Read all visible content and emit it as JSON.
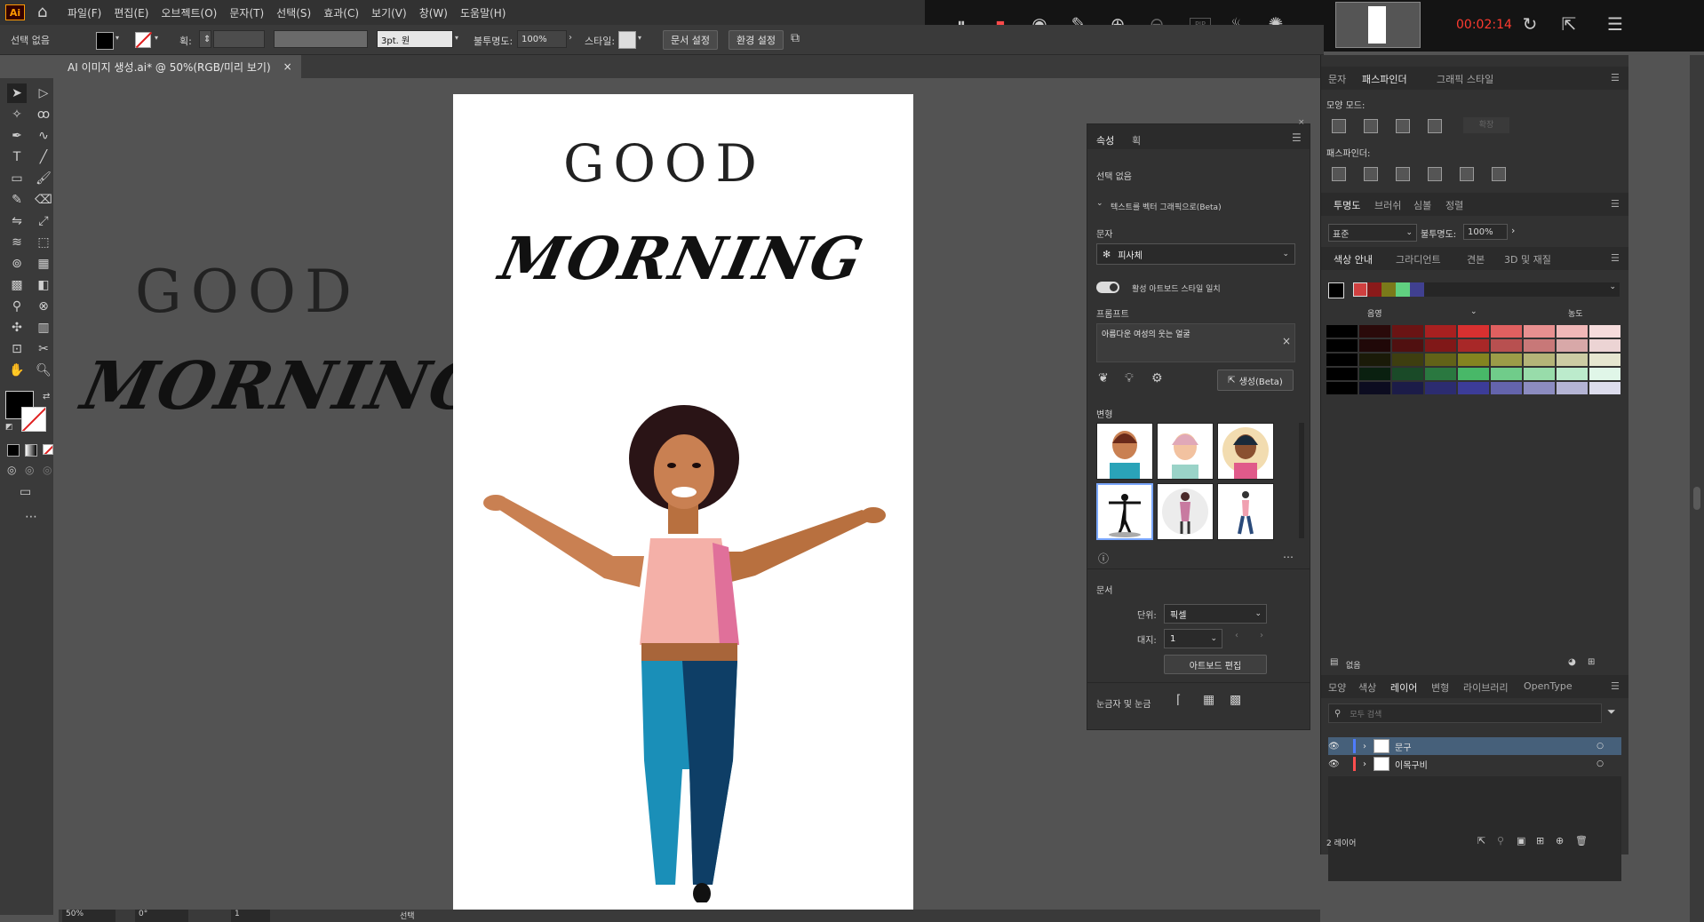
{
  "menubar": {
    "logo": "Ai",
    "items": [
      "파일(F)",
      "편집(E)",
      "오브젝트(O)",
      "문자(T)",
      "선택(S)",
      "효과(C)",
      "보기(V)",
      "창(W)",
      "도움말(H)"
    ]
  },
  "recorder": {
    "time": "00:02:14",
    "zoom_label": "x1",
    "pip_label": "PIP"
  },
  "control_bar": {
    "selection": "선택 없음",
    "stroke_label": "획:",
    "brush_value": "3pt. 원",
    "opacity_label": "불투명도:",
    "opacity_value": "100%",
    "style_label": "스타일:",
    "doc_setup_button": "문서 설정",
    "prefs_button": "환경 설정"
  },
  "document_tab": {
    "title": "AI 이미지 생성.ai* @ 50%(RGB/미리 보기)",
    "close": "×"
  },
  "canvas": {
    "left_good": "GOOD",
    "left_morning": "MORNING",
    "art_good": "GOOD",
    "art_morning": "MORNING"
  },
  "properties_panel": {
    "tabs": [
      "속성",
      "획"
    ],
    "no_selection": "선택 없음",
    "vectorize_header": "텍스트를 벡터 그래픽으로(Beta)",
    "type_label": "문자",
    "type_value": "피사체",
    "toggle_label": "활성 아트보드 스타일 일치",
    "prompt_label": "프롬프트",
    "prompt_text": "아름다운 여성의 웃는 얼굴",
    "generate_button": "생성(Beta)",
    "variants_label": "변형",
    "document_label": "문서",
    "unit_label": "단위:",
    "unit_value": "픽셀",
    "artboard_label": "대지:",
    "artboard_value": "1",
    "edit_artboard_button": "아트보드 편집",
    "rulers_label": "눈금자 및 눈금"
  },
  "dock": {
    "top_tabs": [
      "문자",
      "패스파인더",
      "그래픽 스타일"
    ],
    "shape_mode_label": "모양 모드:",
    "expand_button": "확장",
    "pathfinder_label": "패스파인더:",
    "transparency_tabs": [
      "투명도",
      "브러쉬",
      "심볼",
      "정렬"
    ],
    "blend_mode": "표준",
    "opacity_label": "불투명도:",
    "opacity_value": "100%",
    "color_tabs": [
      "색상 안내",
      "그라디언트",
      "견본",
      "3D 및 재질"
    ],
    "shade_label": "음영",
    "vivid_label": "농도",
    "guide_footer": "없음",
    "layer_tabs": [
      "모양",
      "색상",
      "레이어",
      "변형",
      "라이브러리",
      "OpenType"
    ],
    "search_placeholder": "모두 검색",
    "layers": [
      {
        "name": "문구",
        "color": "#4f7cff"
      },
      {
        "name": "이목구비",
        "color": "#ff4f4f"
      }
    ],
    "layer_count": "2 레이어"
  },
  "status_bar": {
    "zoom": "50%",
    "rotation": "0°",
    "artboard": "1",
    "tool": "선택"
  },
  "colors": {
    "accent_red": "#ff3b30",
    "panel_bg": "#323232",
    "ui_bg": "#535353"
  }
}
